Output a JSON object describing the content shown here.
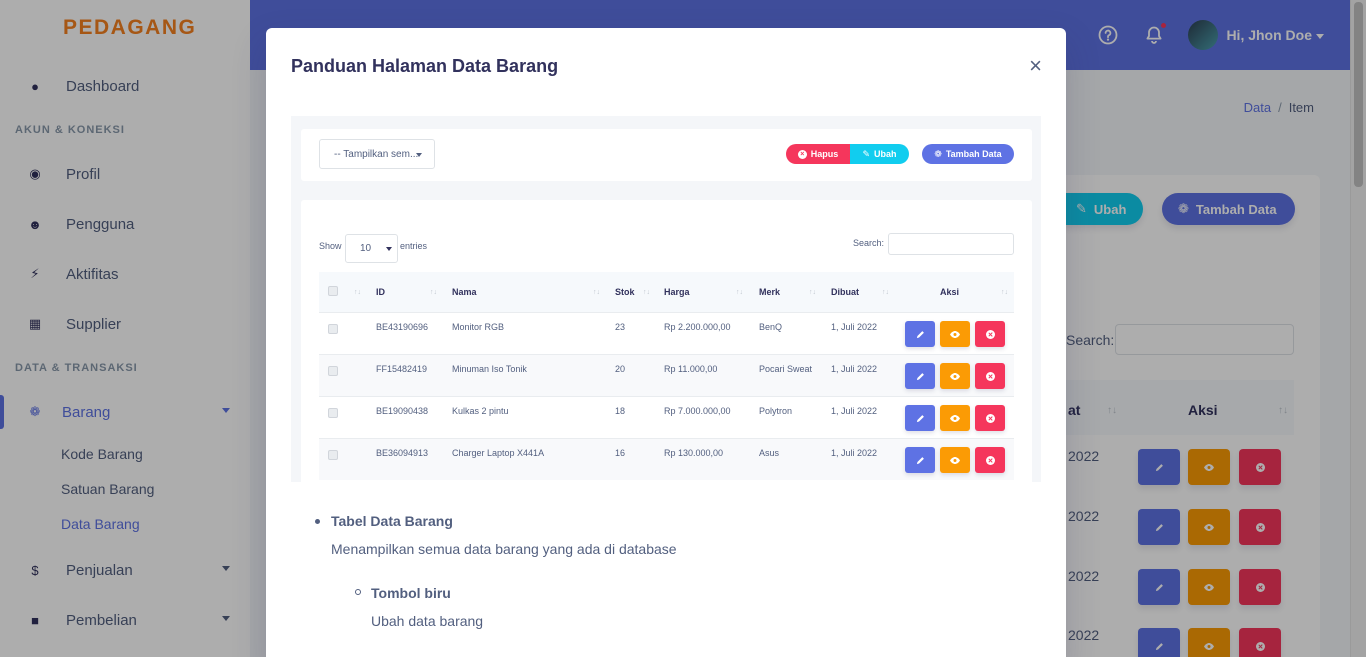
{
  "app": {
    "brand": "PEDAGANG"
  },
  "sidebar": {
    "dashboard": "Dashboard",
    "section_akun": "AKUN & KONEKSI",
    "profil": "Profil",
    "pengguna": "Pengguna",
    "aktifitas": "Aktifitas",
    "supplier": "Supplier",
    "section_data": "DATA & TRANSAKSI",
    "barang": "Barang",
    "sub": [
      "Kode Barang",
      "Satuan Barang",
      "Data Barang"
    ],
    "penjualan": "Penjualan",
    "pembelian": "Pembelian"
  },
  "topbar": {
    "user": "Hi, Jhon Doe"
  },
  "breadcrumb": {
    "data": "Data",
    "sep": "/",
    "item": "Item"
  },
  "background": {
    "ubah": "Ubah",
    "tambah": "Tambah Data",
    "search_label": "Search:",
    "col_at": "at",
    "col_aksi": "Aksi",
    "rows": [
      "2022",
      "2022",
      "2022",
      "2022"
    ]
  },
  "modal": {
    "title": "Panduan Halaman Data Barang",
    "close": "×",
    "filter_placeholder": "-- Tampilkan sem...",
    "hapus": "Hapus",
    "ubah": "Ubah",
    "tambah": "Tambah Data",
    "show": "Show",
    "entries_value": "10",
    "entries": "entries",
    "search": "Search:",
    "columns": [
      "ID",
      "Nama",
      "Stok",
      "Harga",
      "Merk",
      "Dibuat",
      "Aksi"
    ],
    "rows": [
      {
        "id": "BE43190696",
        "nama": "Monitor RGB",
        "stok": "23",
        "harga": "Rp 2.200.000,00",
        "merk": "BenQ",
        "dibuat": "1, Juli 2022"
      },
      {
        "id": "FF15482419",
        "nama": "Minuman Iso Tonik",
        "stok": "20",
        "harga": "Rp 11.000,00",
        "merk": "Pocari Sweat",
        "dibuat": "1, Juli 2022"
      },
      {
        "id": "BE19090438",
        "nama": "Kulkas 2 pintu",
        "stok": "18",
        "harga": "Rp 7.000.000,00",
        "merk": "Polytron",
        "dibuat": "1, Juli 2022"
      },
      {
        "id": "BE36094913",
        "nama": "Charger Laptop X441A",
        "stok": "16",
        "harga": "Rp 130.000,00",
        "merk": "Asus",
        "dibuat": "1, Juli 2022"
      }
    ],
    "guide": [
      {
        "title": "Tabel Data Barang",
        "desc": "Menampilkan semua data barang yang ada di database"
      },
      {
        "title": "Tombol biru",
        "desc": "Ubah data barang"
      }
    ]
  },
  "colors": {
    "primary": "#5e72e4",
    "info": "#11cdef",
    "warning": "#fb9b05",
    "danger": "#f5365c",
    "brand": "#f5811f"
  }
}
